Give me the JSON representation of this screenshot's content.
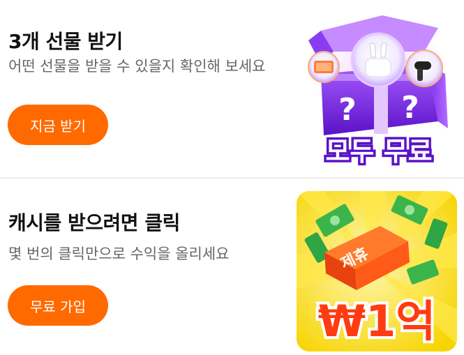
{
  "gift_card": {
    "title": "3개 선물 받기",
    "subtitle": "어떤 선물을 받을 수 있을지 확인해 보세요",
    "button_label": "지금 받기",
    "image_badge": "모두 무료"
  },
  "cash_card": {
    "title": "캐시를 받으려면 클릭",
    "subtitle": "몇 번의 클릭만으로 수익을 올리세요",
    "button_label": "무료 가입",
    "image_tag": "제휴",
    "image_amount": "₩1억"
  },
  "colors": {
    "accent": "#ff6a00",
    "title": "#111111",
    "subtitle": "#666666"
  }
}
